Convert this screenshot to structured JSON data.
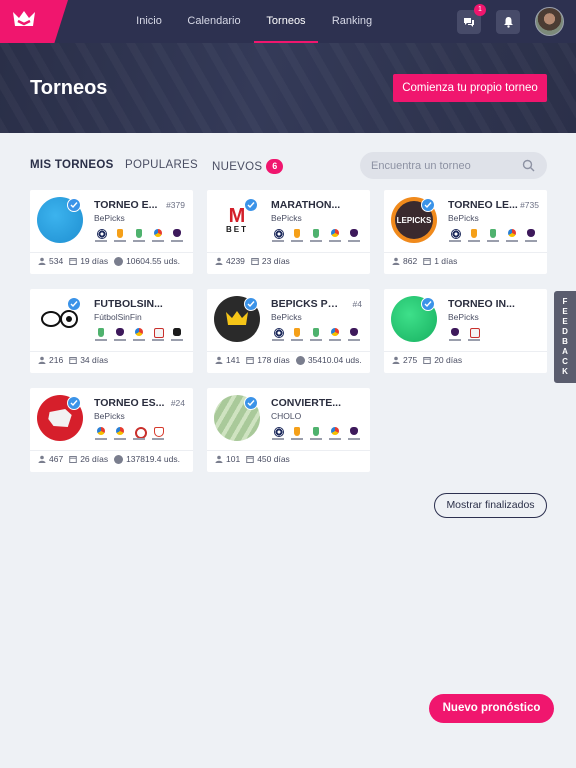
{
  "nav": {
    "links": [
      "Inicio",
      "Calendario",
      "Torneos",
      "Ranking"
    ],
    "active": "Torneos",
    "messages_count": "1",
    "accent_color": "#f0166e",
    "bar_color": "#2d3150"
  },
  "hero": {
    "title": "Torneos",
    "create_button": "Comienza tu propio torneo"
  },
  "tabs": {
    "mine": "MIS TORNEOS",
    "popular": "POPULARES",
    "new": "NUEVOS",
    "new_count": "6"
  },
  "search": {
    "placeholder": "Encuentra un torneo"
  },
  "tournaments": [
    {
      "name": "TORNEO E...",
      "number": "#379",
      "org": "BePicks",
      "players": "534",
      "days": "19 días",
      "prize": "10604.55 uds.",
      "logo": "blue-ball",
      "comps": [
        "ucl",
        "uel",
        "ecl",
        "liga",
        "pl"
      ]
    },
    {
      "name": "MARATHON...",
      "number": "",
      "org": "BePicks",
      "players": "4239",
      "days": "23 días",
      "prize": "",
      "logo": "mbet",
      "comps": [
        "ucl",
        "uel",
        "ecl",
        "liga",
        "pl"
      ]
    },
    {
      "name": "TORNEO LE...",
      "number": "#735",
      "org": "BePicks",
      "players": "862",
      "days": "1 días",
      "prize": "",
      "logo": "lepicks",
      "comps": [
        "ucl",
        "uel",
        "ecl",
        "liga",
        "pl"
      ]
    },
    {
      "name": "FUTBOLSIN...",
      "number": "",
      "org": "FútbolSinFin",
      "players": "216",
      "days": "34 días",
      "prize": "",
      "logo": "infinity-ball",
      "comps": [
        "ecl",
        "pl",
        "liga",
        "copa",
        "coach"
      ]
    },
    {
      "name": "BEPICKS PRO",
      "number": "#4",
      "org": "BePicks",
      "players": "141",
      "days": "178 días",
      "prize": "35410.04 uds.",
      "logo": "crown",
      "comps": [
        "ucl",
        "uel",
        "ecl",
        "liga",
        "pl"
      ]
    },
    {
      "name": "TORNEO IN...",
      "number": "",
      "org": "BePicks",
      "players": "275",
      "days": "20 días",
      "prize": "",
      "logo": "green-ball",
      "comps": [
        "pl",
        "copa"
      ]
    },
    {
      "name": "TORNEO ES...",
      "number": "#24",
      "org": "BePicks",
      "players": "467",
      "days": "26 días",
      "prize": "137819.4 uds.",
      "logo": "spain-map",
      "comps": [
        "liga",
        "liga",
        "rfef",
        "cup"
      ]
    },
    {
      "name": "CONVIERTE...",
      "number": "",
      "org": "CHOLO",
      "players": "101",
      "days": "450 días",
      "prize": "",
      "logo": "money",
      "comps": [
        "ucl",
        "uel",
        "ecl",
        "liga",
        "pl"
      ]
    }
  ],
  "buttons": {
    "finished": "Mostrar finalizados",
    "new_prediction": "Nuevo pronóstico"
  },
  "feedback": [
    "F",
    "E",
    "E",
    "D",
    "B",
    "A",
    "C",
    "K"
  ]
}
